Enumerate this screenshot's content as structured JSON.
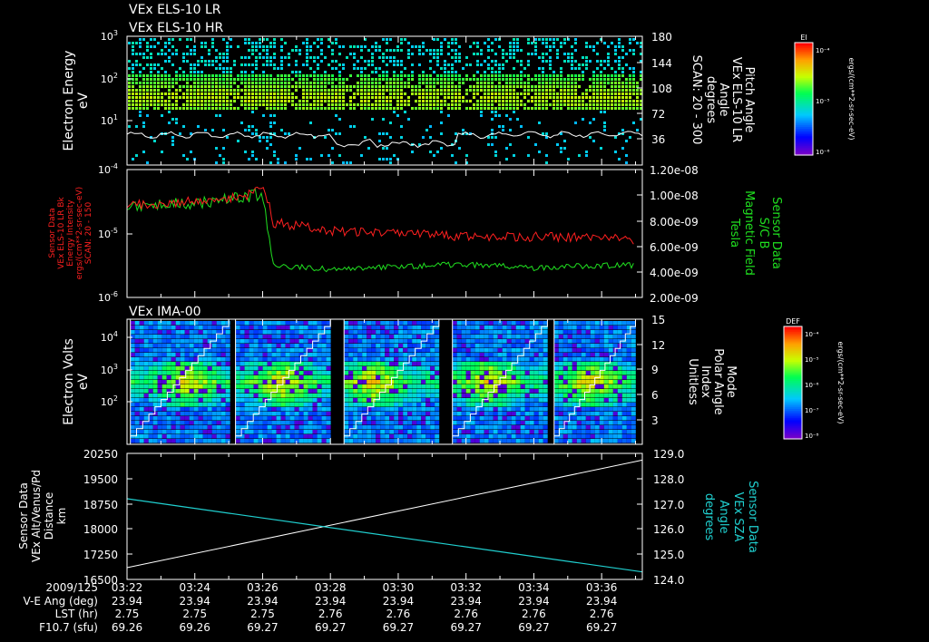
{
  "header": {
    "line1": "VEx ELS-10 LR",
    "line2": "VEx ELS-10 HR",
    "ima_title": "VEx IMA-00"
  },
  "panel1": {
    "ylabel_line1": "Electron Energy",
    "ylabel_line2": "eV",
    "yticks": [
      {
        "base": "10",
        "exp": "3"
      },
      {
        "base": "10",
        "exp": "2"
      },
      {
        "base": "10",
        "exp": "1"
      }
    ],
    "right_ticks": [
      "180",
      "144",
      "108",
      "72",
      "36"
    ],
    "right_label": [
      "Pitch Angle",
      "VEx ELS-10 LR",
      "Angle",
      "degrees",
      "SCAN: 20 - 300"
    ],
    "colorbar": {
      "title": "El",
      "labels": [
        "10⁻⁴",
        "10⁻⁵",
        "10⁻⁶"
      ],
      "unit": "ergs/(cm**2-sr-sec-eV)"
    }
  },
  "panel2": {
    "left_label": [
      "Sensor Data",
      "VEx ELS-10 LR Bk",
      "Energy Intensity",
      "ergs/(cm**2-sr-sec-eV)",
      "SCAN: 20 - 150"
    ],
    "yticks": [
      {
        "base": "10",
        "exp": "-4"
      },
      {
        "base": "10",
        "exp": "-5"
      },
      {
        "base": "10",
        "exp": "-6"
      }
    ],
    "right_ticks": [
      "1.20e-08",
      "1.00e-08",
      "8.00e-09",
      "6.00e-09",
      "4.00e-09",
      "2.00e-09"
    ],
    "right_label": [
      "Sensor Data",
      "S/C B",
      "Magnetic Field",
      "Tesla"
    ],
    "red_color": "#ff2020",
    "green_color": "#20e020"
  },
  "panel3": {
    "ylabel_line1": "Electron Volts",
    "ylabel_line2": "eV",
    "yticks": [
      {
        "base": "10",
        "exp": "4"
      },
      {
        "base": "10",
        "exp": "3"
      },
      {
        "base": "10",
        "exp": "2"
      }
    ],
    "right_ticks": [
      "15",
      "12",
      "9",
      "6",
      "3"
    ],
    "right_label": [
      "Mode",
      "Polar Angle",
      "Index",
      "Unitless"
    ],
    "colorbar": {
      "title": "DEF",
      "labels": [
        "10⁻⁴",
        "10⁻⁵",
        "10⁻⁶",
        "10⁻⁷",
        "10⁻⁸"
      ],
      "unit": "ergs/(cm**2-sr-sec-eV)"
    }
  },
  "panel4": {
    "left_label": [
      "Sensor Data",
      "VEx Alt/Venus/Pd",
      "Distance",
      "km"
    ],
    "left_ticks": [
      "20250",
      "19500",
      "18750",
      "18000",
      "17250",
      "16500"
    ],
    "right_ticks": [
      "129.0",
      "128.0",
      "127.0",
      "126.0",
      "125.0",
      "124.0"
    ],
    "right_label": [
      "Sensor Data",
      "VEx SZA",
      "Angle",
      "degrees"
    ],
    "cyan_color": "#20d0d0"
  },
  "footer": {
    "row_labels": [
      "2009/125",
      "V-E Ang (deg)",
      "LST (hr)",
      "F10.7 (sfu)"
    ],
    "times": [
      "03:22",
      "03:24",
      "03:26",
      "03:28",
      "03:30",
      "03:32",
      "03:34",
      "03:36"
    ],
    "ve_ang": [
      "23.94",
      "23.94",
      "23.94",
      "23.94",
      "23.94",
      "23.94",
      "23.94",
      "23.94"
    ],
    "lst": [
      "2.75",
      "2.75",
      "2.75",
      "2.76",
      "2.76",
      "2.76",
      "2.76",
      "2.76"
    ],
    "f107": [
      "69.26",
      "69.26",
      "69.27",
      "69.27",
      "69.27",
      "69.27",
      "69.27",
      "69.27"
    ]
  },
  "chart_data": [
    {
      "type": "heatmap",
      "title": "VEx ELS-10 LR / VEx ELS-10 HR",
      "ylabel": "Electron Energy (eV)",
      "y_scale": "log",
      "ylim": [
        1,
        1000
      ],
      "x_range": [
        "03:22",
        "03:37"
      ],
      "overlay_ylabel": "Pitch Angle VEx ELS-10 LR Angle degrees",
      "overlay_ylim": [
        0,
        180
      ],
      "note_values": {
        "peak_energy_ev_approx": 40
      }
    },
    {
      "type": "line",
      "x_range": [
        "03:22",
        "03:37"
      ],
      "series": [
        {
          "name": "VEx ELS-10 LR Bk Energy Intensity",
          "axis": "left",
          "ylim": [
            1e-06,
            0.0001
          ],
          "x": [
            "03:22",
            "03:24",
            "03:25.5",
            "03:26",
            "03:26.3",
            "03:28",
            "03:30",
            "03:32",
            "03:34",
            "03:36",
            "03:37"
          ],
          "values": [
            2.8e-05,
            3.2e-05,
            4e-05,
            5e-05,
            1.5e-05,
            1.1e-05,
            1e-05,
            9e-06,
            9e-06,
            8.5e-06,
            8e-06
          ]
        },
        {
          "name": "S/C B Magnetic Field",
          "axis": "right",
          "ylim": [
            2e-09,
            1.2e-08
          ],
          "x": [
            "03:22",
            "03:24",
            "03:25.5",
            "03:26",
            "03:26.3",
            "03:28",
            "03:30",
            "03:32",
            "03:34",
            "03:36",
            "03:37"
          ],
          "values": [
            9.2e-09,
            9.4e-09,
            9.8e-09,
            1.02e-08,
            4.5e-09,
            4.2e-09,
            4.4e-09,
            4.6e-09,
            4.3e-09,
            4.5e-09,
            4.5e-09
          ]
        }
      ]
    },
    {
      "type": "heatmap",
      "title": "VEx IMA-00",
      "ylabel": "Electron Volts (eV)",
      "y_scale": "log",
      "ylim": [
        10,
        30000
      ],
      "x_range": [
        "03:22",
        "03:37"
      ],
      "overlay_ylabel": "Mode Polar Angle Index Unitless",
      "overlay_ylim": [
        0,
        15
      ]
    },
    {
      "type": "line",
      "x": [
        "03:22",
        "03:37"
      ],
      "series": [
        {
          "name": "VEx Alt/Venus/Pd Distance",
          "axis": "left",
          "ylim": [
            16500,
            20250
          ],
          "values": [
            16850,
            20050
          ]
        },
        {
          "name": "VEx SZA Angle",
          "axis": "right",
          "ylim": [
            124.0,
            129.0
          ],
          "values": [
            127.2,
            124.3
          ]
        }
      ]
    }
  ]
}
